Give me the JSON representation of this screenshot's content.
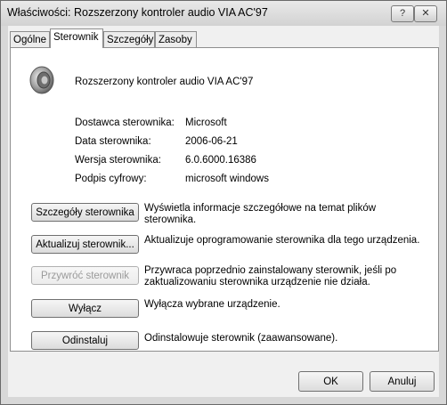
{
  "window": {
    "title": "Właściwości: Rozszerzony kontroler audio VIA AC'97",
    "help_label": "?",
    "close_label": "✕"
  },
  "tabs": [
    {
      "label": "Ogólne",
      "active": false
    },
    {
      "label": "Sterownik",
      "active": true
    },
    {
      "label": "Szczegóły",
      "active": false
    },
    {
      "label": "Zasoby",
      "active": false
    }
  ],
  "device": {
    "icon": "speaker-icon",
    "name": "Rozszerzony kontroler audio VIA AC'97"
  },
  "properties": [
    {
      "label": "Dostawca sterownika:",
      "value": "Microsoft"
    },
    {
      "label": "Data sterownika:",
      "value": "2006-06-21"
    },
    {
      "label": "Wersja sterownika:",
      "value": "6.0.6000.16386"
    },
    {
      "label": "Podpis cyfrowy:",
      "value": "microsoft windows"
    }
  ],
  "actions": [
    {
      "button": "Szczegóły sterownika",
      "description": "Wyświetla informacje szczegółowe na temat plików sterownika.",
      "enabled": true
    },
    {
      "button": "Aktualizuj sterownik...",
      "description": "Aktualizuje oprogramowanie sterownika dla tego urządzenia.",
      "enabled": true
    },
    {
      "button": "Przywróć sterownik",
      "description": "Przywraca poprzednio zainstalowany sterownik, jeśli po zaktualizowaniu sterownika urządzenie nie działa.",
      "enabled": false
    },
    {
      "button": "Wyłącz",
      "description": "Wyłącza wybrane urządzenie.",
      "enabled": true
    },
    {
      "button": "Odinstaluj",
      "description": "Odinstalowuje sterownik (zaawansowane).",
      "enabled": true
    }
  ],
  "footer": {
    "ok": "OK",
    "cancel": "Anuluj"
  }
}
